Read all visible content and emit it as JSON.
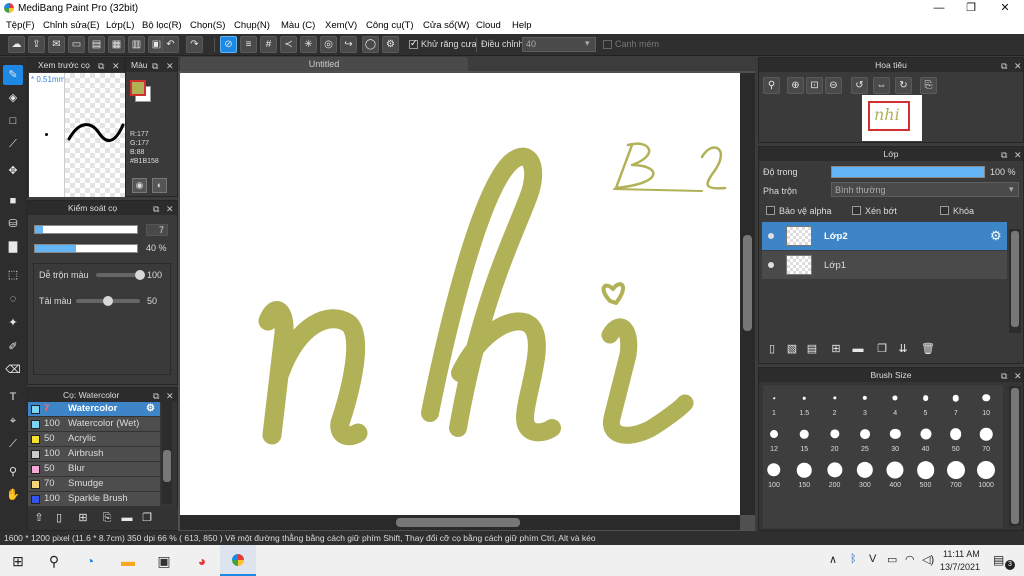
{
  "window": {
    "title": "MediBang Paint Pro (32bit)"
  },
  "menu": [
    "Tệp(F)",
    "Chỉnh sửa(E)",
    "Lớp(L)",
    "Bộ lọc(R)",
    "Chọn(S)",
    "Chụp(N)",
    "Màu (C)",
    "Xem(V)",
    "Công cụ(T)",
    "Cửa sổ(W)",
    "Cloud",
    "Help"
  ],
  "toolbar": {
    "antialias_label": "Khử răng cưa",
    "adjust_label": "Điều chỉnh",
    "adjust_value": "40",
    "snap_label": "Canh mém"
  },
  "brush_preview": {
    "title": "Xem trước cọ",
    "size_label": "* 0.51mm"
  },
  "color_panel": {
    "title": "Màu",
    "r": "R:177",
    "g": "G:177",
    "b": "B:88",
    "hex": "#B1B158",
    "color": "#B1B158"
  },
  "brush_control": {
    "title": "Kiểm soát cọ",
    "size_value": "7",
    "size_fraction": 0.08,
    "opacity_value": "40 %",
    "opacity_fraction": 0.4,
    "blend_label": "Dễ trộn màu",
    "blend_value": "100",
    "blend_fraction": 1.0,
    "reload_label": "Tải màu",
    "reload_value": "50",
    "reload_fraction": 0.5
  },
  "brush_list": {
    "title": "Cọ: Watercolor",
    "items": [
      {
        "size": "7",
        "name": "Watercolor",
        "color": "#7dd3f5",
        "selected": true
      },
      {
        "size": "100",
        "name": "Watercolor (Wet)",
        "color": "#7dd3f5",
        "selected": false
      },
      {
        "size": "50",
        "name": "Acrylic",
        "color": "#f5e12e",
        "selected": false
      },
      {
        "size": "100",
        "name": "Airbrush",
        "color": "#cccccc",
        "selected": false
      },
      {
        "size": "50",
        "name": "Blur",
        "color": "#f7a8d8",
        "selected": false
      },
      {
        "size": "70",
        "name": "Smudge",
        "color": "#f5d77a",
        "selected": false
      },
      {
        "size": "100",
        "name": "Sparkle Brush",
        "color": "#3355ee",
        "selected": false
      }
    ]
  },
  "canvas": {
    "tab_title": "Untitled",
    "drawing_text": "nhi",
    "drawing_note": "B2",
    "ink_color": "#B1B158"
  },
  "navigator": {
    "title": "Hoa tiêu"
  },
  "layers": {
    "title": "Lớp",
    "opacity_label": "Độ trong",
    "opacity_value": "100 %",
    "opacity_fraction": 1.0,
    "blend_label": "Pha trộn",
    "blend_value": "Bình thường",
    "protect_alpha": "Bảo vệ alpha",
    "clipping": "Xén bớt",
    "lock": "Khóa",
    "items": [
      {
        "name": "Lớp2",
        "selected": true
      },
      {
        "name": "Lớp1",
        "selected": false
      }
    ]
  },
  "brush_size": {
    "title": "Brush Size",
    "sizes": [
      "1",
      "1.5",
      "2",
      "3",
      "4",
      "5",
      "7",
      "10",
      "12",
      "15",
      "20",
      "25",
      "30",
      "40",
      "50",
      "70",
      "100",
      "150",
      "200",
      "300",
      "400",
      "500",
      "700",
      "1000"
    ]
  },
  "status": {
    "text": "1600 * 1200 pixel   (11.6 * 8.7cm)   350 dpi   66 %   ( 613, 850 )   Vẽ một đường thẳng bằng cách giữ phím Shift, Thay đổi cỡ cọ bằng cách giữ phím Ctrl, Alt và kéo"
  },
  "taskbar": {
    "time": "11:11 AM",
    "date": "13/7/2021",
    "notification_count": "3"
  }
}
